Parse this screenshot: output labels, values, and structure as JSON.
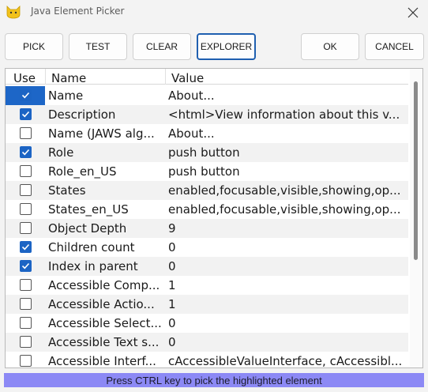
{
  "window": {
    "title": "Java Element Picker",
    "icon": "yellow-cat-icon",
    "close_icon": "close-icon"
  },
  "toolbar": {
    "pick_label": "PICK",
    "test_label": "TEST",
    "clear_label": "CLEAR",
    "explorer_label": "EXPLORER",
    "ok_label": "OK",
    "cancel_label": "CANCEL"
  },
  "table": {
    "columns": [
      "Use",
      "Name",
      "Value"
    ],
    "rows": [
      {
        "checked": true,
        "selected": true,
        "name": "Name",
        "value": "About..."
      },
      {
        "checked": true,
        "selected": false,
        "name": "Description",
        "value": "<html>View information about this v..."
      },
      {
        "checked": false,
        "selected": false,
        "name": "Name (JAWS alg...",
        "value": "About..."
      },
      {
        "checked": true,
        "selected": false,
        "name": "Role",
        "value": "push button"
      },
      {
        "checked": false,
        "selected": false,
        "name": "Role_en_US",
        "value": "push button"
      },
      {
        "checked": false,
        "selected": false,
        "name": "States",
        "value": "enabled,focusable,visible,showing,op..."
      },
      {
        "checked": false,
        "selected": false,
        "name": "States_en_US",
        "value": "enabled,focusable,visible,showing,op..."
      },
      {
        "checked": false,
        "selected": false,
        "name": "Object Depth",
        "value": "9"
      },
      {
        "checked": true,
        "selected": false,
        "name": "Children count",
        "value": "0"
      },
      {
        "checked": true,
        "selected": false,
        "name": "Index in parent",
        "value": "0"
      },
      {
        "checked": false,
        "selected": false,
        "name": "Accessible Comp...",
        "value": "1"
      },
      {
        "checked": false,
        "selected": false,
        "name": "Accessible Actio...",
        "value": "1"
      },
      {
        "checked": false,
        "selected": false,
        "name": "Accessible Select...",
        "value": "0"
      },
      {
        "checked": false,
        "selected": false,
        "name": "Accessible Text s...",
        "value": "0"
      },
      {
        "checked": false,
        "selected": false,
        "name": "Accessible Interf...",
        "value": "cAccessibleValueInterface, cAccessibl..."
      }
    ]
  },
  "status": {
    "text": "Press CTRL key to pick the highlighted element"
  },
  "colors": {
    "accent": "#1c64c4",
    "status_bar": "#8c89f5"
  }
}
